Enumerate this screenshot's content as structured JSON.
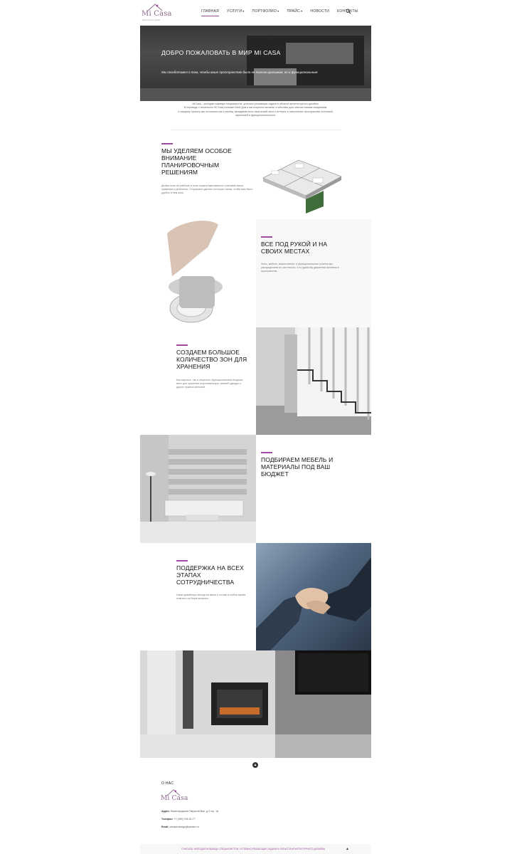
{
  "brand": {
    "name": "Mi Casa",
    "tagline": "архитектура и дизайн",
    "accent_color": "#a04aa3"
  },
  "nav": {
    "items": [
      {
        "label": "ГЛАВНАЯ",
        "active": true,
        "dropdown": false
      },
      {
        "label": "УСЛУГИ",
        "active": false,
        "dropdown": true
      },
      {
        "label": "ПОРТФОЛИО",
        "active": false,
        "dropdown": true
      },
      {
        "label": "ПРАЙС",
        "active": false,
        "dropdown": true
      },
      {
        "label": "НОВОСТИ",
        "active": false,
        "dropdown": false
      },
      {
        "label": "КОНТАКТЫ",
        "active": false,
        "dropdown": false
      }
    ],
    "caret": "▾",
    "search_icon": "search-icon"
  },
  "hero": {
    "title": "ДОБРО ПОЖАЛОВАТЬ В МИР MI CASA",
    "subtitle": "Мы позаботимся о том, чтобы ваше пространство было не только красивым, но и функциональным"
  },
  "intro": {
    "lines": [
      "MiCasa – молодая команда специалистов, успешно решающая задачи в области архитектурного дизайна.",
      "В переводе с испанского Mi Casa означает Мой Дом и мы искренне желаем, чтобы ваш дом отвечал вашим ожиданиям.",
      "К каждому проекту мы относимся как к своему, вкладывая весь творческий опыт и интерес в наполнение пространства эстетикой,",
      "гармонией и функциональностью."
    ]
  },
  "features": [
    {
      "title": "МЫ УДЕЛЯЕМ ОСОБОЕ ВНИМАНИЕ ПЛАНИРОВОЧНЫМ РЕШЕНИЯМ",
      "text": "Делим зоны на рабочие и зоны отдыха максимально учитывая ваши привычки и увлечения. Стараемся сделать интерьер таким, чтобы вам было удобно в нем жить."
    },
    {
      "title": "ВСЕ ПОД РУКОЙ И НА СВОИХ МЕСТАХ",
      "text": "Зоны, мебель, выключатели, и функциональные розетки мы распределяем не как попало, а по удобству движения человека в пространстве."
    },
    {
      "title": "СОЗДАЕМ БОЛЬШОЕ КОЛИЧЕСТВО ЗОН ДЛЯ ХРАНЕНИЯ",
      "text": "Как скрытых, так и открытых, функциональных входных, мест для хранения спортинвентаря, зимней одежды и других нужных мелочей."
    },
    {
      "title": "ПОДБИРАЕМ МЕБЕЛЬ И МАТЕРИАЛЫ ПОД ВАШ БЮДЖЕТ",
      "text": ""
    },
    {
      "title": "ПОДДЕРЖКА НА ВСЕХ ЭТАПАХ СОТРУДНИЧЕСТВА",
      "text": "Наши дизайнеры всегда на связи и готовы в любое время ответить на Ваши вопросы."
    }
  ],
  "footer": {
    "heading": "О НАС",
    "address_label": "Адрес:",
    "address": "Нижегородская Тверской Вал, д.3 стр. 1а",
    "phone_label": "Телефон:",
    "phone": "+7 (499) 704-00-77",
    "email_label": "Email:",
    "email": "micasa.design@yandex.ru",
    "copyright": "© MICASA, МОЛОДАЯ КОМАНДА СПЕЦИАЛИСТОВ, УСПЕШНО РЕШАЮЩАЯ ЗАДАЧИ В ОБЛАСТИ АРХИТЕКТУРНОГО ДИЗАЙНА",
    "up_arrow": "▲"
  },
  "back_to_top_icon": "▲"
}
